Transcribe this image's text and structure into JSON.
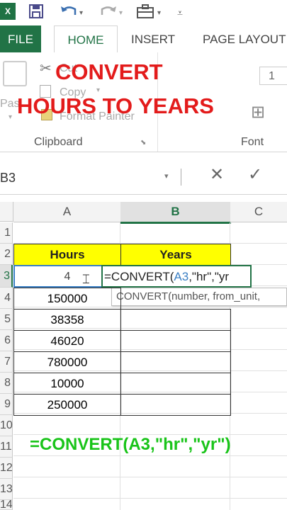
{
  "qat": {
    "logo": "X",
    "icons": [
      "save-icon",
      "undo-icon",
      "redo-icon",
      "briefcase-icon",
      "customize-icon"
    ]
  },
  "tabs": [
    "FILE",
    "HOME",
    "INSERT",
    "PAGE LAYOUT"
  ],
  "ribbon": {
    "paste_label": "Pas",
    "cut_label": "Cut",
    "copy_label": "Copy",
    "format_painter_label": "Format Painter",
    "clipboard_group": "Clipboard",
    "font_group": "Font",
    "font_size": "1"
  },
  "overlay": {
    "line1": "CONVERT",
    "line2": "HOURS TO YEARS"
  },
  "formula_bar": {
    "name_box": "B3",
    "cancel": "✕",
    "enter": "✓"
  },
  "grid": {
    "columns": [
      "A",
      "B",
      "C"
    ],
    "rows": [
      "1",
      "2",
      "3",
      "4",
      "5",
      "6",
      "7",
      "8",
      "9",
      "10",
      "11",
      "12",
      "13",
      "14"
    ],
    "header_hours": "Hours",
    "header_years": "Years",
    "a3_value": "4",
    "b3_formula": "=CONVERT(A3,\"hr\",\"yr",
    "formula_prefix": "=CONVERT(",
    "formula_ref": "A3",
    "formula_suffix": ",\"hr\",\"yr",
    "tooltip": "CONVERT(number, from_unit,",
    "hours_values": [
      "150000",
      "38358",
      "46020",
      "780000",
      "10000",
      "250000"
    ],
    "caption": "=CONVERT(A3,\"hr\",\"yr\")"
  },
  "colors": {
    "accent": "#217346",
    "title_red": "#e31b1b",
    "header_yellow": "#ffff00",
    "caption_green": "#19c419"
  }
}
